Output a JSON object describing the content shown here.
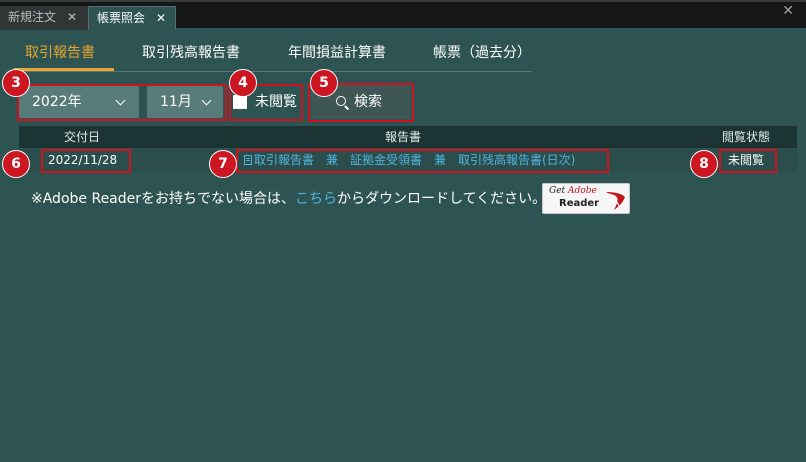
{
  "window_tabs": [
    {
      "label": "新規注文",
      "close": "✕",
      "active": false
    },
    {
      "label": "帳票照会",
      "close": "✕",
      "active": true
    }
  ],
  "window_close": "✕",
  "sub_tabs": [
    {
      "label": "取引報告書",
      "active": true
    },
    {
      "label": "取引残高報告書",
      "active": false
    },
    {
      "label": "年間損益計算書",
      "active": false
    },
    {
      "label": "帳票（過去分）",
      "active": false
    }
  ],
  "filters": {
    "year": "2022年",
    "month": "11月",
    "unread_label": "未閲覧",
    "unread_checked": false,
    "search_label": "検索"
  },
  "table": {
    "headers": [
      "交付日",
      "報告書",
      "閲覧状態"
    ],
    "rows": [
      {
        "date": "2022/11/28",
        "report": "取引報告書　兼　証拠金受領書　兼　取引残高報告書(日次)",
        "status": "未閲覧"
      }
    ]
  },
  "note": {
    "prefix": "※Adobe Readerをお持ちでない場合は、",
    "link": "こちら",
    "suffix": "からダウンロードしてください。"
  },
  "adobe_badge": {
    "get": "Get",
    "brand": "Adobe",
    "product": "Reader"
  },
  "callouts": [
    "3",
    "4",
    "5",
    "6",
    "7",
    "8"
  ],
  "colors": {
    "background": "#2d5352",
    "accent": "#e8a530",
    "link": "#51b3dc",
    "callout": "#cc1622"
  }
}
